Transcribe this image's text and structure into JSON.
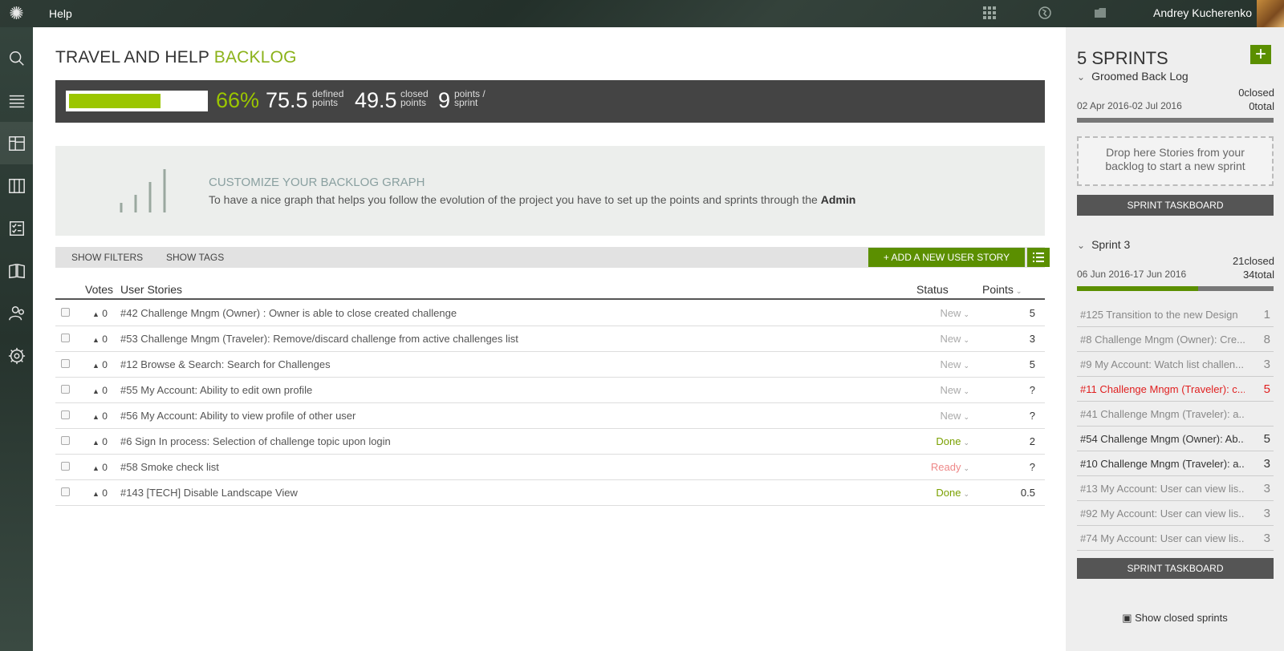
{
  "topbar": {
    "help_label": "Help",
    "user_name": "Andrey Kucherenko",
    "icons": [
      "apps-grid-icon",
      "globe-icon",
      "folder-icon"
    ]
  },
  "sidebar": {
    "items": [
      "search-icon",
      "menu-icon",
      "backlog-icon",
      "kanban-icon",
      "issues-icon",
      "wiki-icon",
      "team-icon",
      "settings-icon"
    ]
  },
  "page": {
    "title_prefix": "TRAVEL AND HELP",
    "title_highlight": "BACKLOG"
  },
  "summary": {
    "progress": 0.66,
    "percent": "66%",
    "defined_value": "75.5",
    "defined_l1": "defined",
    "defined_l2": "points",
    "closed_value": "49.5",
    "closed_l1": "closed",
    "closed_l2": "points",
    "sprint_value": "9",
    "sprint_l1": "points /",
    "sprint_l2": "sprint"
  },
  "graph": {
    "title": "CUSTOMIZE YOUR BACKLOG GRAPH",
    "text": "To have a nice graph that helps you follow the evolution of the project you have to set up the points and sprints through the",
    "admin": "Admin"
  },
  "toolbar": {
    "show_filters": "SHOW FILTERS",
    "show_tags": "SHOW TAGS",
    "add_story": "+ ADD A NEW USER STORY"
  },
  "table": {
    "headers": {
      "votes": "Votes",
      "stories": "User Stories",
      "status": "Status",
      "points": "Points"
    },
    "rows": [
      {
        "votes": "0",
        "story": "#42 Challenge Mngm (Owner) : Owner is able to close created challenge",
        "status": "New",
        "points": "5"
      },
      {
        "votes": "0",
        "story": "#53 Challenge Mngm (Traveler): Remove/discard challenge from active challenges list",
        "status": "New",
        "points": "3"
      },
      {
        "votes": "0",
        "story": "#12 Browse & Search: Search for Challenges",
        "status": "New",
        "points": "5"
      },
      {
        "votes": "0",
        "story": "#55 My Account: Ability to edit own profile",
        "status": "New",
        "points": "?"
      },
      {
        "votes": "0",
        "story": "#56 My Account: Ability to view profile of other user",
        "status": "New",
        "points": "?"
      },
      {
        "votes": "0",
        "story": "#6 Sign In process: Selection of challenge topic upon login",
        "status": "Done",
        "points": "2"
      },
      {
        "votes": "0",
        "story": "#58 Smoke check list",
        "status": "Ready",
        "points": "?"
      },
      {
        "votes": "0",
        "story": "#143 [TECH] Disable Landscape View",
        "status": "Done",
        "points": "0.5"
      }
    ]
  },
  "sprints": {
    "title": "5 SPRINTS",
    "groomed": {
      "name": "Groomed Back Log",
      "closed": "0closed",
      "total": "0total",
      "dates": "02 Apr 2016-02 Jul 2016",
      "progress": 0,
      "dropzone_l1": "Drop here Stories from your",
      "dropzone_l2": "backlog to start a new sprint",
      "taskboard": "SPRINT TASKBOARD"
    },
    "sprint3": {
      "name": "Sprint 3",
      "closed": "21closed",
      "total": "34total",
      "dates": "06 Jun 2016-17 Jun 2016",
      "progress": 0.6176,
      "items": [
        {
          "text": "#125 Transition to the new Design",
          "points": "1",
          "style": "muted"
        },
        {
          "text": "#8 Challenge Mngm (Owner): Cre...",
          "points": "8",
          "style": "muted"
        },
        {
          "text": "#9 My Account: Watch list challen...",
          "points": "3",
          "style": "muted"
        },
        {
          "text": "#11 Challenge Mngm (Traveler): c...",
          "points": "5",
          "style": "red"
        },
        {
          "text": "#41 Challenge Mngm (Traveler): a...",
          "points": "",
          "style": "muted"
        },
        {
          "text": "#54 Challenge Mngm (Owner): Ab...",
          "points": "5",
          "style": "dark"
        },
        {
          "text": "#10 Challenge Mngm (Traveler): a...",
          "points": "3",
          "style": "dark"
        },
        {
          "text": "#13 My Account: User can view lis...",
          "points": "3",
          "style": "muted"
        },
        {
          "text": "#92 My Account: User can view lis...",
          "points": "3",
          "style": "muted"
        },
        {
          "text": "#74 My Account: User can view lis...",
          "points": "3",
          "style": "muted"
        }
      ],
      "taskboard": "SPRINT TASKBOARD"
    },
    "show_closed": "Show closed sprints"
  },
  "colors": {
    "accent_green": "#8bb21a",
    "button_green": "#5b8f00",
    "red": "#e02020"
  }
}
